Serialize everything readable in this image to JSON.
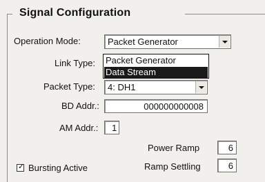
{
  "group": {
    "title": "Signal Configuration"
  },
  "operation_mode": {
    "label": "Operation Mode:",
    "value": "Packet Generator",
    "options": [
      "Packet Generator",
      "Data Stream"
    ],
    "highlighted": "Data Stream"
  },
  "link_type": {
    "label": "Link Type:"
  },
  "packet_type": {
    "label": "Packet Type:",
    "value": "4: DH1"
  },
  "bd_addr": {
    "label": "BD Addr.:",
    "value": "000000000008"
  },
  "am_addr": {
    "label": "AM Addr.:",
    "value": "1"
  },
  "power_ramp": {
    "label": "Power Ramp",
    "value": "6"
  },
  "ramp_settling": {
    "label": "Ramp Settling",
    "value": "6"
  },
  "bursting": {
    "label": "Bursting Active",
    "checked": true
  }
}
